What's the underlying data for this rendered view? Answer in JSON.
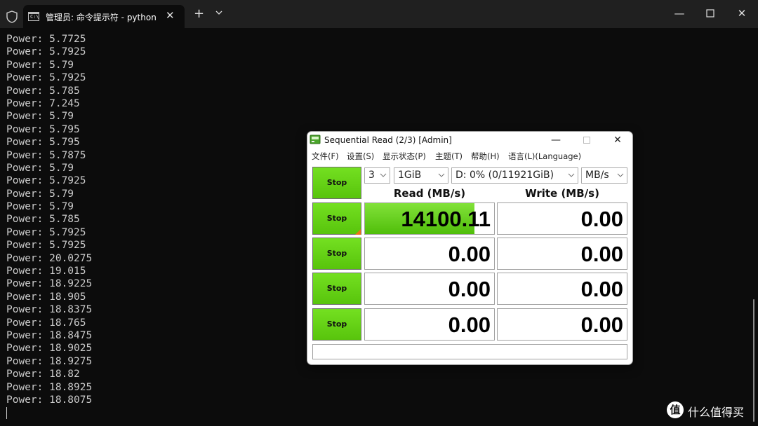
{
  "terminal": {
    "tab_title": "管理员: 命令提示符 - python p",
    "tab_icon_text": "C:\\",
    "lines": [
      "Power: 5.7725",
      "Power: 5.7925",
      "Power: 5.79",
      "Power: 5.7925",
      "Power: 5.785",
      "Power: 7.245",
      "Power: 5.79",
      "Power: 5.795",
      "Power: 5.795",
      "Power: 5.7875",
      "Power: 5.79",
      "Power: 5.7925",
      "Power: 5.79",
      "Power: 5.79",
      "Power: 5.785",
      "Power: 5.7925",
      "Power: 5.7925",
      "Power: 20.0275",
      "Power: 19.015",
      "Power: 18.9225",
      "Power: 18.905",
      "Power: 18.8375",
      "Power: 18.765",
      "Power: 18.8475",
      "Power: 18.9025",
      "Power: 18.9275",
      "Power: 18.82",
      "Power: 18.8925",
      "Power: 18.8075"
    ]
  },
  "cdm": {
    "title": "Sequential Read (2/3) [Admin]",
    "menu": [
      "文件(F)",
      "设置(S)",
      "显示状态(P)",
      "主题(T)",
      "帮助(H)",
      "语言(L)(Language)"
    ],
    "controls": {
      "count": "3",
      "size": "1GiB",
      "drive": "D: 0% (0/11921GiB)",
      "unit": "MB/s"
    },
    "read_header": "Read (MB/s)",
    "write_header": "Write (MB/s)",
    "stop_labels": [
      "Stop",
      "Stop",
      "Stop",
      "Stop",
      "Stop"
    ],
    "rows": [
      {
        "read": "14100.11",
        "write": "0.00",
        "read_progress": 0.85
      },
      {
        "read": "0.00",
        "write": "0.00",
        "read_progress": 0
      },
      {
        "read": "0.00",
        "write": "0.00",
        "read_progress": 0
      },
      {
        "read": "0.00",
        "write": "0.00",
        "read_progress": 0
      }
    ],
    "status_text": ""
  },
  "watermark": {
    "logo_text": "值",
    "text": "什么值得买"
  },
  "colors": {
    "terminal_bg": "#0c0c0c",
    "terminal_text": "#cccccc",
    "stop_green": "#5cc611",
    "progress_green": "#66d11a",
    "corner_orange": "#f07018"
  }
}
